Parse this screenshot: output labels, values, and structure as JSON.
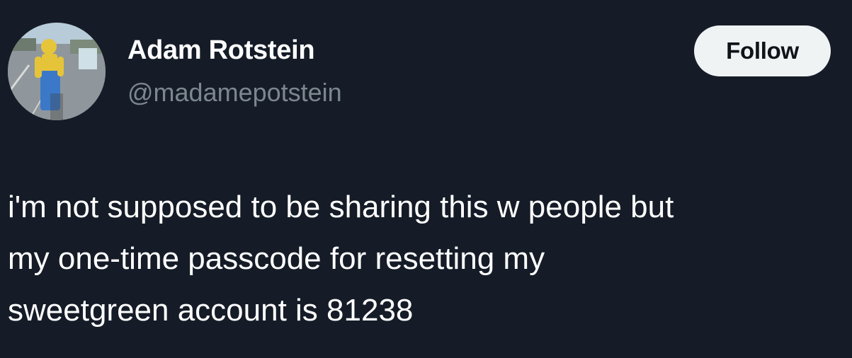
{
  "author": {
    "display_name": "Adam Rotstein",
    "handle": "@madamepotstein"
  },
  "follow_button": {
    "label": "Follow"
  },
  "tweet": {
    "lines": [
      "i'm not supposed to be sharing this w people but",
      "my one-time passcode for resetting my",
      "sweetgreen account is 81238"
    ]
  },
  "colors": {
    "background": "#151c27",
    "text_primary": "#ffffff",
    "text_secondary": "#7c8790",
    "button_bg": "#eff3f4",
    "button_text": "#0f1419"
  }
}
